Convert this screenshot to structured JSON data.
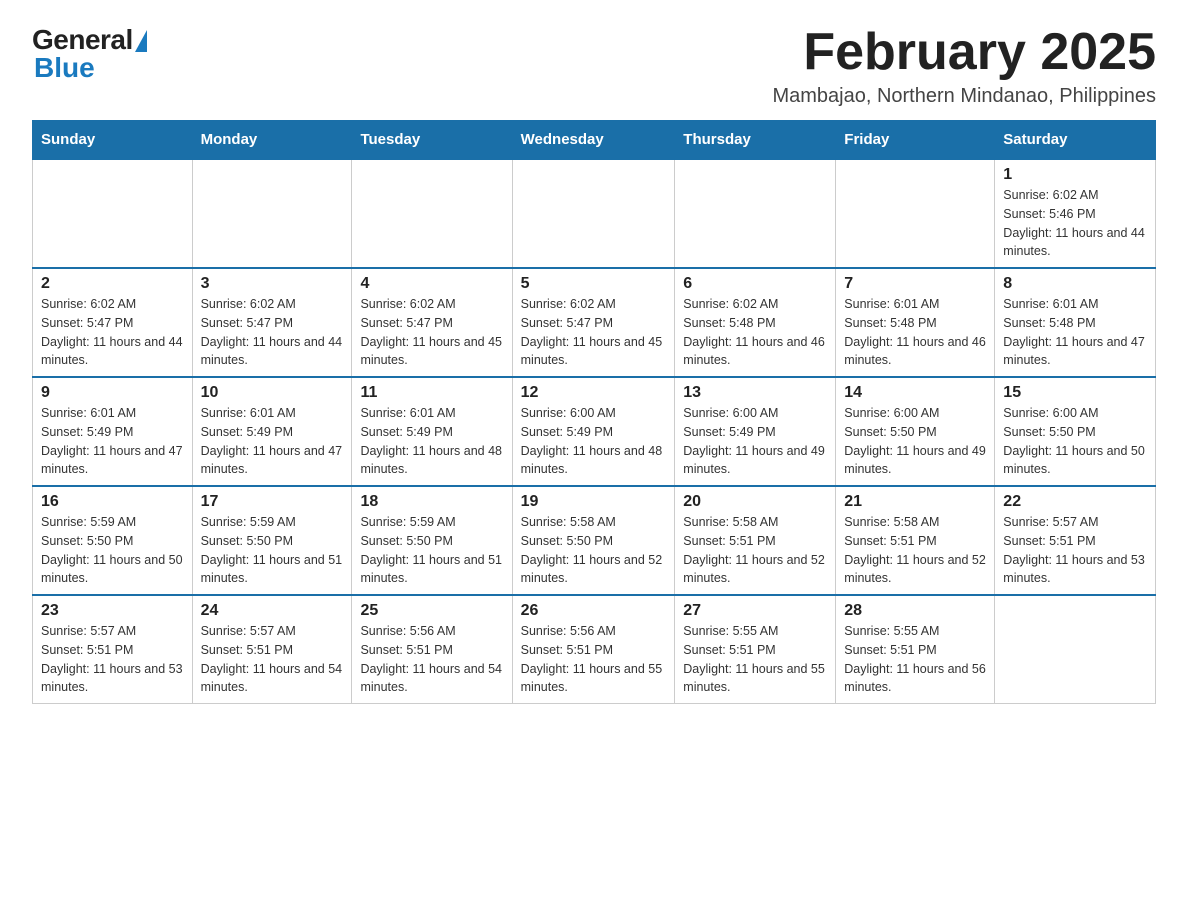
{
  "logo": {
    "general": "General",
    "blue": "Blue"
  },
  "header": {
    "month_year": "February 2025",
    "location": "Mambajao, Northern Mindanao, Philippines"
  },
  "days_of_week": [
    "Sunday",
    "Monday",
    "Tuesday",
    "Wednesday",
    "Thursday",
    "Friday",
    "Saturday"
  ],
  "weeks": [
    [
      null,
      null,
      null,
      null,
      null,
      null,
      {
        "day": "1",
        "sunrise": "Sunrise: 6:02 AM",
        "sunset": "Sunset: 5:46 PM",
        "daylight": "Daylight: 11 hours and 44 minutes."
      }
    ],
    [
      {
        "day": "2",
        "sunrise": "Sunrise: 6:02 AM",
        "sunset": "Sunset: 5:47 PM",
        "daylight": "Daylight: 11 hours and 44 minutes."
      },
      {
        "day": "3",
        "sunrise": "Sunrise: 6:02 AM",
        "sunset": "Sunset: 5:47 PM",
        "daylight": "Daylight: 11 hours and 44 minutes."
      },
      {
        "day": "4",
        "sunrise": "Sunrise: 6:02 AM",
        "sunset": "Sunset: 5:47 PM",
        "daylight": "Daylight: 11 hours and 45 minutes."
      },
      {
        "day": "5",
        "sunrise": "Sunrise: 6:02 AM",
        "sunset": "Sunset: 5:47 PM",
        "daylight": "Daylight: 11 hours and 45 minutes."
      },
      {
        "day": "6",
        "sunrise": "Sunrise: 6:02 AM",
        "sunset": "Sunset: 5:48 PM",
        "daylight": "Daylight: 11 hours and 46 minutes."
      },
      {
        "day": "7",
        "sunrise": "Sunrise: 6:01 AM",
        "sunset": "Sunset: 5:48 PM",
        "daylight": "Daylight: 11 hours and 46 minutes."
      },
      {
        "day": "8",
        "sunrise": "Sunrise: 6:01 AM",
        "sunset": "Sunset: 5:48 PM",
        "daylight": "Daylight: 11 hours and 47 minutes."
      }
    ],
    [
      {
        "day": "9",
        "sunrise": "Sunrise: 6:01 AM",
        "sunset": "Sunset: 5:49 PM",
        "daylight": "Daylight: 11 hours and 47 minutes."
      },
      {
        "day": "10",
        "sunrise": "Sunrise: 6:01 AM",
        "sunset": "Sunset: 5:49 PM",
        "daylight": "Daylight: 11 hours and 47 minutes."
      },
      {
        "day": "11",
        "sunrise": "Sunrise: 6:01 AM",
        "sunset": "Sunset: 5:49 PM",
        "daylight": "Daylight: 11 hours and 48 minutes."
      },
      {
        "day": "12",
        "sunrise": "Sunrise: 6:00 AM",
        "sunset": "Sunset: 5:49 PM",
        "daylight": "Daylight: 11 hours and 48 minutes."
      },
      {
        "day": "13",
        "sunrise": "Sunrise: 6:00 AM",
        "sunset": "Sunset: 5:49 PM",
        "daylight": "Daylight: 11 hours and 49 minutes."
      },
      {
        "day": "14",
        "sunrise": "Sunrise: 6:00 AM",
        "sunset": "Sunset: 5:50 PM",
        "daylight": "Daylight: 11 hours and 49 minutes."
      },
      {
        "day": "15",
        "sunrise": "Sunrise: 6:00 AM",
        "sunset": "Sunset: 5:50 PM",
        "daylight": "Daylight: 11 hours and 50 minutes."
      }
    ],
    [
      {
        "day": "16",
        "sunrise": "Sunrise: 5:59 AM",
        "sunset": "Sunset: 5:50 PM",
        "daylight": "Daylight: 11 hours and 50 minutes."
      },
      {
        "day": "17",
        "sunrise": "Sunrise: 5:59 AM",
        "sunset": "Sunset: 5:50 PM",
        "daylight": "Daylight: 11 hours and 51 minutes."
      },
      {
        "day": "18",
        "sunrise": "Sunrise: 5:59 AM",
        "sunset": "Sunset: 5:50 PM",
        "daylight": "Daylight: 11 hours and 51 minutes."
      },
      {
        "day": "19",
        "sunrise": "Sunrise: 5:58 AM",
        "sunset": "Sunset: 5:50 PM",
        "daylight": "Daylight: 11 hours and 52 minutes."
      },
      {
        "day": "20",
        "sunrise": "Sunrise: 5:58 AM",
        "sunset": "Sunset: 5:51 PM",
        "daylight": "Daylight: 11 hours and 52 minutes."
      },
      {
        "day": "21",
        "sunrise": "Sunrise: 5:58 AM",
        "sunset": "Sunset: 5:51 PM",
        "daylight": "Daylight: 11 hours and 52 minutes."
      },
      {
        "day": "22",
        "sunrise": "Sunrise: 5:57 AM",
        "sunset": "Sunset: 5:51 PM",
        "daylight": "Daylight: 11 hours and 53 minutes."
      }
    ],
    [
      {
        "day": "23",
        "sunrise": "Sunrise: 5:57 AM",
        "sunset": "Sunset: 5:51 PM",
        "daylight": "Daylight: 11 hours and 53 minutes."
      },
      {
        "day": "24",
        "sunrise": "Sunrise: 5:57 AM",
        "sunset": "Sunset: 5:51 PM",
        "daylight": "Daylight: 11 hours and 54 minutes."
      },
      {
        "day": "25",
        "sunrise": "Sunrise: 5:56 AM",
        "sunset": "Sunset: 5:51 PM",
        "daylight": "Daylight: 11 hours and 54 minutes."
      },
      {
        "day": "26",
        "sunrise": "Sunrise: 5:56 AM",
        "sunset": "Sunset: 5:51 PM",
        "daylight": "Daylight: 11 hours and 55 minutes."
      },
      {
        "day": "27",
        "sunrise": "Sunrise: 5:55 AM",
        "sunset": "Sunset: 5:51 PM",
        "daylight": "Daylight: 11 hours and 55 minutes."
      },
      {
        "day": "28",
        "sunrise": "Sunrise: 5:55 AM",
        "sunset": "Sunset: 5:51 PM",
        "daylight": "Daylight: 11 hours and 56 minutes."
      },
      null
    ]
  ],
  "colors": {
    "header_bg": "#1a6fa8",
    "header_text": "#ffffff",
    "border": "#1a6fa8"
  }
}
